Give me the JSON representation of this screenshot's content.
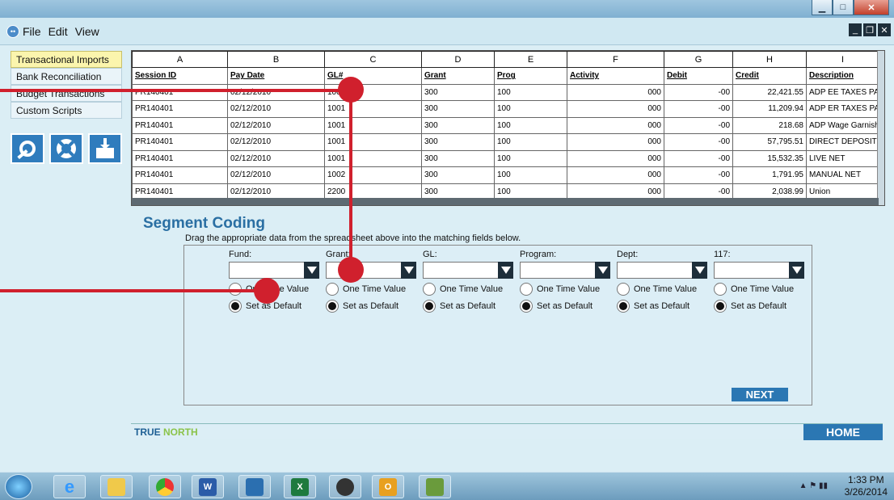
{
  "menu": {
    "items": [
      "File",
      "Edit",
      "View"
    ]
  },
  "sidebar": {
    "items": [
      {
        "label": "Transactional Imports",
        "active": true
      },
      {
        "label": "Bank Reconciliation",
        "active": false
      },
      {
        "label": "Budget Transactions",
        "active": false
      },
      {
        "label": "Custom Scripts",
        "active": false
      }
    ],
    "tools": [
      "settings-icon",
      "lifebuoy-icon",
      "download-box-icon"
    ]
  },
  "sheet": {
    "columns": [
      "A",
      "B",
      "C",
      "D",
      "E",
      "F",
      "G",
      "H",
      "I"
    ],
    "header_row": [
      "Session ID",
      "Pay Date",
      "GL#",
      "Grant",
      "Prog",
      "Activity",
      "Debit",
      "Credit",
      "Description"
    ],
    "rows": [
      [
        "PR140401",
        "02/12/2010",
        "1001",
        "300",
        "100",
        "000",
        "-00",
        "22,421.55",
        "ADP EE TAXES PAID"
      ],
      [
        "PR140401",
        "02/12/2010",
        "1001",
        "300",
        "100",
        "000",
        "-00",
        "11,209.94",
        "ADP ER TAXES PAID"
      ],
      [
        "PR140401",
        "02/12/2010",
        "1001",
        "300",
        "100",
        "000",
        "-00",
        "218.68",
        "ADP Wage Garnishments PAI"
      ],
      [
        "PR140401",
        "02/12/2010",
        "1001",
        "300",
        "100",
        "000",
        "-00",
        "57,795.51",
        "DIRECT DEPOSIT"
      ],
      [
        "PR140401",
        "02/12/2010",
        "1001",
        "300",
        "100",
        "000",
        "-00",
        "15,532.35",
        "LIVE NET"
      ],
      [
        "PR140401",
        "02/12/2010",
        "1002",
        "300",
        "100",
        "000",
        "-00",
        "1,791.95",
        "MANUAL NET"
      ],
      [
        "PR140401",
        "02/12/2010",
        "2200",
        "300",
        "100",
        "000",
        "-00",
        "2,038.99",
        "Union"
      ]
    ]
  },
  "segment": {
    "title": "Segment Coding",
    "subtitle": "Drag the appropriate data from the spreadsheet above into the matching fields below.",
    "fields": [
      {
        "label": "Fund:",
        "one_time": "One Time Value",
        "default": "Set as Default"
      },
      {
        "label": "Grant:",
        "one_time": "One Time Value",
        "default": "Set as Default"
      },
      {
        "label": "GL:",
        "one_time": "One Time Value",
        "default": "Set as Default"
      },
      {
        "label": "Program:",
        "one_time": "One Time Value",
        "default": "Set as Default"
      },
      {
        "label": "Dept:",
        "one_time": "One Time Value",
        "default": "Set as Default"
      },
      {
        "label": "117:",
        "one_time": "One Time Value",
        "default": "Set as Default"
      }
    ],
    "next_label": "NEXT"
  },
  "footer": {
    "brand_a": "TRUE",
    "brand_b": " NORTH",
    "home_label": "HOME"
  },
  "taskbar": {
    "time": "1:33 PM",
    "date": "3/26/2014"
  }
}
